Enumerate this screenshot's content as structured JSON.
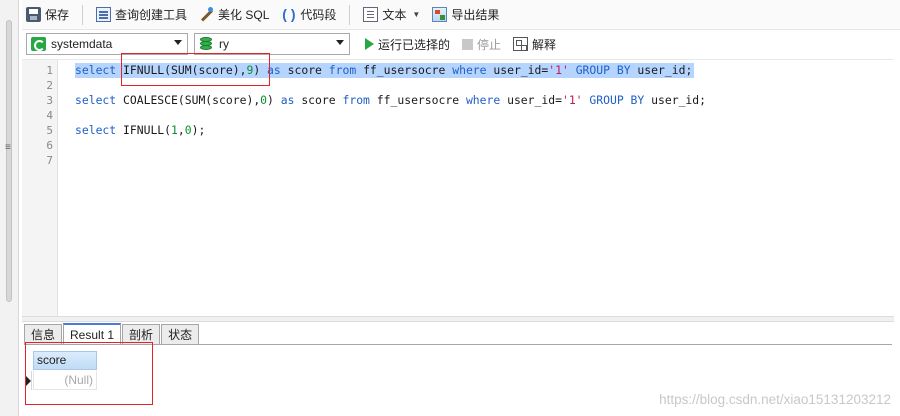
{
  "toolbar": {
    "save": "保存",
    "query_builder": "查询创建工具",
    "beautify_sql": "美化 SQL",
    "code_snippet": "代码段",
    "text": "文本",
    "export_results": "导出结果"
  },
  "connection_bar": {
    "connection": "systemdata",
    "database": "ry",
    "run_selected": "运行已选择的",
    "stop": "停止",
    "explain": "解释"
  },
  "editor": {
    "line_numbers": [
      "1",
      "2",
      "3",
      "4",
      "5",
      "6",
      "7"
    ],
    "lines": [
      {
        "tokens": [
          [
            "kw",
            "select "
          ],
          [
            "id",
            "IFNULL(SUM(score),"
          ],
          [
            "num",
            "9"
          ],
          [
            "id",
            ") "
          ],
          [
            "kw",
            "as"
          ],
          [
            "id",
            " score "
          ],
          [
            "kw",
            "from"
          ],
          [
            "id",
            " ff_usersocre "
          ],
          [
            "kw",
            "where"
          ],
          [
            "id",
            " user_id="
          ],
          [
            "str",
            "'1'"
          ],
          [
            "id",
            " "
          ],
          [
            "kw",
            "GROUP BY"
          ],
          [
            "id",
            " user_id;"
          ]
        ]
      },
      {
        "tokens": []
      },
      {
        "tokens": [
          [
            "kw",
            "select "
          ],
          [
            "id",
            "COALESCE(SUM(score),"
          ],
          [
            "num",
            "0"
          ],
          [
            "id",
            ") "
          ],
          [
            "kw",
            "as"
          ],
          [
            "id",
            " score "
          ],
          [
            "kw",
            "from"
          ],
          [
            "id",
            " ff_usersocre "
          ],
          [
            "kw",
            "where"
          ],
          [
            "id",
            " user_id="
          ],
          [
            "str",
            "'1'"
          ],
          [
            "id",
            " "
          ],
          [
            "kw",
            "GROUP BY"
          ],
          [
            "id",
            " user_id;"
          ]
        ]
      },
      {
        "tokens": []
      },
      {
        "tokens": [
          [
            "kw",
            "select "
          ],
          [
            "id",
            "IFNULL("
          ],
          [
            "num",
            "1"
          ],
          [
            "id",
            ","
          ],
          [
            "num",
            "0"
          ],
          [
            "id",
            ");"
          ]
        ]
      },
      {
        "tokens": []
      },
      {
        "tokens": []
      }
    ]
  },
  "result_tabs": [
    {
      "label": "信息",
      "active": false
    },
    {
      "label": "Result 1",
      "active": true
    },
    {
      "label": "剖析",
      "active": false
    },
    {
      "label": "状态",
      "active": false
    }
  ],
  "result_grid": {
    "column_header": "score",
    "rows": [
      [
        "(Null)"
      ]
    ]
  },
  "watermark": "https://blog.csdn.net/xiao15131203212",
  "colors": {
    "keyword": "#1f5fc8",
    "number": "#0a8f2f",
    "string": "#c2185b",
    "selection": "#b5d5ff",
    "annotation": "#e0242a"
  }
}
